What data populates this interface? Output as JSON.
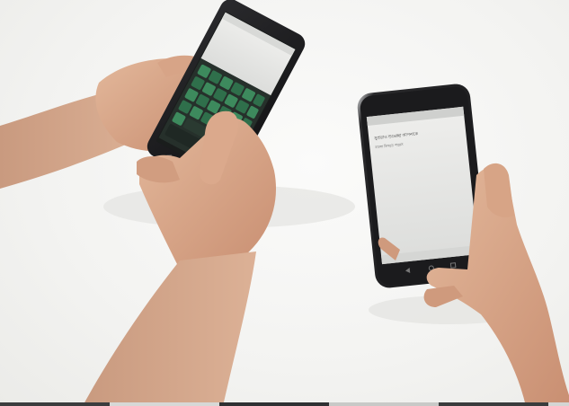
{
  "photo": {
    "left_phone": {
      "label": "left-phone-keyboard"
    },
    "right_phone": {
      "line1": "সুপ্রভাত শুভেচ্ছা আপনাকে",
      "line2": "বাংলা লিখতে পারেন"
    },
    "colors": {
      "background": "#f4f4f2",
      "skin": "#d9a98a",
      "keyboard": "#2f3b34",
      "keys": "#3f8a5f",
      "phone_dark": "#1d1d1f",
      "screen": "#e7e8e6"
    }
  }
}
